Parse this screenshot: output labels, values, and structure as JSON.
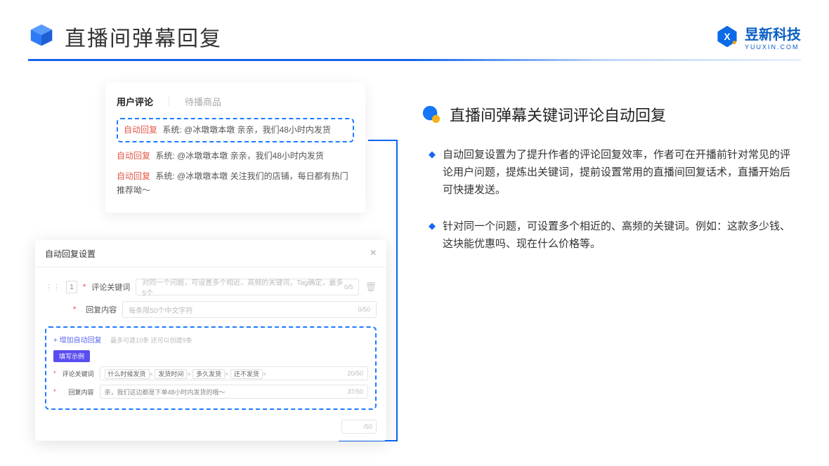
{
  "header": {
    "title": "直播间弹幕回复",
    "brand_name": "昱新科技",
    "brand_sub": "YUUXIN.COM"
  },
  "comments": {
    "tab_active": "用户评论",
    "tab_inactive": "待播商品",
    "auto_tag": "自动回复",
    "sys_prefix": "系统:",
    "item1": "@冰墩墩本墩 亲亲，我们48小时内发货",
    "item2": "@冰墩墩本墩 亲亲，我们48小时内发货",
    "item3": "@冰墩墩本墩 关注我们的店铺，每日都有热门推荐呦～"
  },
  "settings": {
    "title": "自动回复设置",
    "idx": "1",
    "label_kw": "评论关键词",
    "ph_kw": "对同一个问题，可设置多个相近、高频的关键词，Tag确定，最多5个",
    "count_kw": "0/5",
    "label_content": "回复内容",
    "ph_content": "每条限50个中文字符",
    "count_content": "0/50",
    "add": "+ 增加自动回复",
    "add_hint": "最多可建10条 还可以创建9条",
    "example_label": "填写示例",
    "ex_kw1": "什么时候发货",
    "ex_kw2": "发货时间",
    "ex_kw3": "多久发货",
    "ex_kw4": "还不发货",
    "ex_count_kw": "20/50",
    "ex_content": "亲，我们这边都是下单48小时内发货的哦～",
    "ex_count_c": "37/50",
    "footer": "/50"
  },
  "right": {
    "section_title": "直播间弹幕关键词评论自动回复",
    "b1": "自动回复设置为了提升作者的评论回复效率，作者可在开播前针对常见的评论用户问题，提炼出关键词，提前设置常用的直播间回复话术，直播开始后可快捷发送。",
    "b2": "针对同一个问题，可设置多个相近的、高频的关键词。例如：这款多少钱、这块能优惠吗、现在什么价格等。"
  }
}
